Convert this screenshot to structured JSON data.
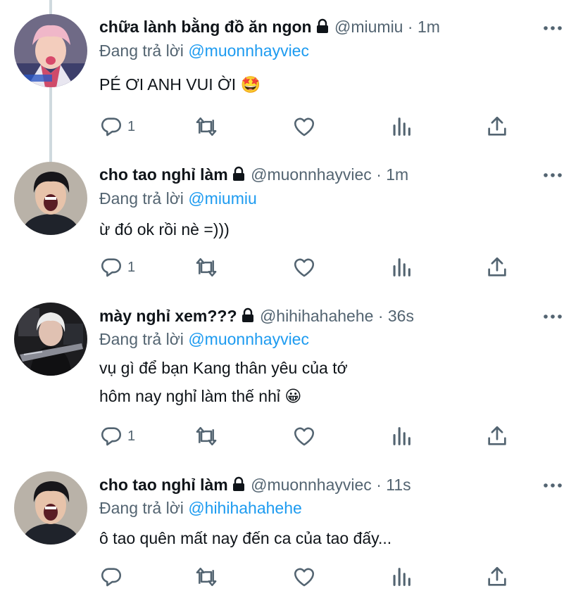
{
  "ui": {
    "replying_prefix": "Đang trả lời",
    "dot": "·",
    "colors": {
      "link": "#1d9bf0",
      "secondary": "#536471",
      "text": "#0f1419",
      "thread_line": "#cfd9de"
    }
  },
  "tweets": [
    {
      "name": "chữa lành bằng đồ ăn ngon",
      "protected": true,
      "handle": "@miumiu",
      "time": "1m",
      "reply_to": "@muonnhayviec",
      "text_lines": [
        "PÉ ƠI ANH VUI ỜI 🤩"
      ],
      "reply_count": "1",
      "avatar": "avatar-idol-pink-hair"
    },
    {
      "name": "cho tao nghỉ làm",
      "protected": true,
      "handle": "@muonnhayviec",
      "time": "1m",
      "reply_to": "@miumiu",
      "text_lines": [
        "ừ đó ok rồi nè =)))"
      ],
      "reply_count": "1",
      "avatar": "avatar-boy-screaming"
    },
    {
      "name": "mày nghỉ xem???",
      "protected": true,
      "handle": "@hihihahahehe",
      "time": "36s",
      "reply_to": "@muonnhayviec",
      "text_lines": [
        "vụ gì để bạn Kang thân yêu của tớ",
        "hôm nay nghỉ làm thế nhỉ 😀"
      ],
      "reply_count": "1",
      "avatar": "avatar-guitarist"
    },
    {
      "name": "cho tao nghỉ làm",
      "protected": true,
      "handle": "@muonnhayviec",
      "time": "11s",
      "reply_to": "@hihihahahehe",
      "text_lines": [
        "ô tao quên mất nay đến ca của tao đấy..."
      ],
      "reply_count": "",
      "avatar": "avatar-boy-screaming"
    }
  ],
  "icons": [
    "reply-icon",
    "retweet-icon",
    "like-icon",
    "analytics-icon",
    "share-icon",
    "more-icon",
    "lock-icon"
  ]
}
